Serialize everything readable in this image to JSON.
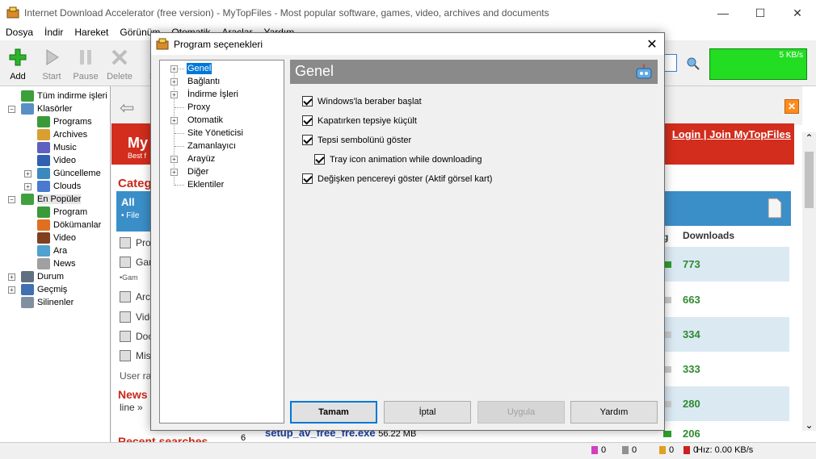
{
  "window": {
    "title": "Internet Download Accelerator (free version) - MyTopFiles - Most popular software, games, video, archives and documents"
  },
  "menu": [
    "Dosya",
    "İndir",
    "Hareket",
    "Görünüm",
    "Otomatik",
    "Araçlar",
    "Yardım"
  ],
  "toolbar": {
    "add": "Add",
    "start": "Start",
    "pause": "Pause",
    "delete": "Delete",
    "st": "St",
    "speed": "5 KB/s"
  },
  "tree": {
    "all": "Tüm indirme işleri",
    "folders": "Klasörler",
    "programs": "Programs",
    "archives": "Archives",
    "music": "Music",
    "video": "Video",
    "updates": "Güncelleme",
    "clouds": "Clouds",
    "popular": "En Popüler",
    "p_program": "Program",
    "p_docs": "Dökümanlar",
    "p_video": "Video",
    "p_search": "Ara",
    "p_news": "News",
    "status": "Durum",
    "history": "Geçmiş",
    "deleted": "Silinenler"
  },
  "browser": {
    "login": "Login",
    "join": "Join MyTopFiles",
    "logo": "My",
    "logo_sub": "Best f",
    "categories": "Categ",
    "all": "All",
    "file": "File",
    "left_items": [
      "Prog",
      "Gam",
      "Gam",
      "Arch",
      "Vide",
      "Doc",
      "Misc"
    ],
    "user_rat": "User rat",
    "news": "News",
    "news_line": "line »",
    "recent": "Recent searches",
    "downloads_header": "Downloads",
    "downloads_col_g": "g",
    "downloads": [
      "773",
      "663",
      "334",
      "333",
      "280",
      "206"
    ],
    "bottom_index": "6",
    "bottom_file": "setup_av_free_fre.exe",
    "bottom_size": "56.22 MB"
  },
  "status": {
    "a": "0",
    "b": "0",
    "c": "0",
    "d": "0",
    "speed": "Hız: 0.00 KB/s"
  },
  "dialog": {
    "title": "Program seçenekleri",
    "tree": [
      "Genel",
      "Bağlantı",
      "İndirme İşleri",
      "Proxy",
      "Otomatik",
      "Site Yöneticisi",
      "Zamanlayıcı",
      "Arayüz",
      "Diğer",
      "Eklentiler"
    ],
    "panel_title": "Genel",
    "options": [
      "Windows'la beraber başlat",
      "Kapatırken tepsiye küçült",
      "Tepsi sembolünü göster",
      "Tray icon animation while downloading",
      "Değişken pencereyi göster (Aktif görsel kart)"
    ],
    "buttons": {
      "ok": "Tamam",
      "cancel": "İptal",
      "apply": "Uygula",
      "help": "Yardım"
    }
  }
}
